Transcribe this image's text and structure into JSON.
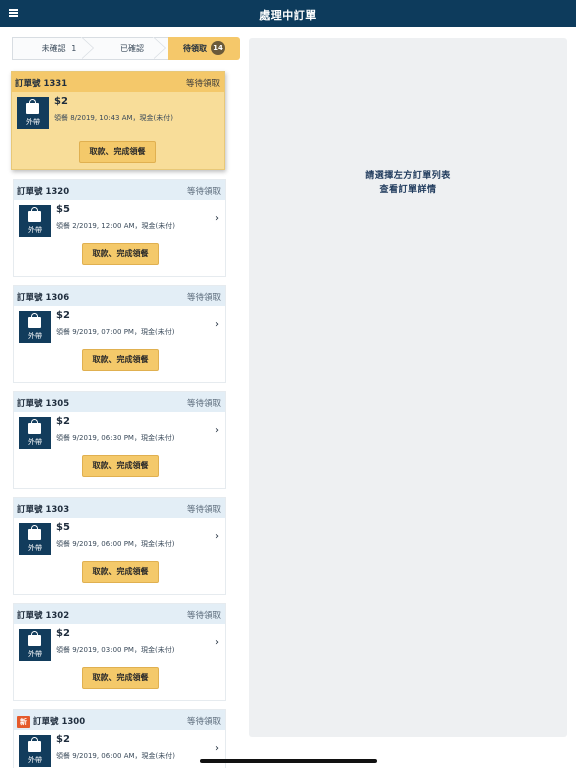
{
  "header": {
    "title": "處理中訂單",
    "menu_icon": "menu-icon"
  },
  "steps": [
    {
      "label": "未確認",
      "count": "1"
    },
    {
      "label": "已確認"
    },
    {
      "label": "待領取",
      "count": "14"
    }
  ],
  "orders": [
    {
      "order_no": "訂單號 1331",
      "status": "等待領取",
      "type_label": "外帶",
      "price": "$2",
      "detail": "領餐 8/2019, 10:43 AM，現金(未付)",
      "action": "取款、完成領餐",
      "selected": true
    },
    {
      "order_no": "訂單號 1320",
      "status": "等待領取",
      "type_label": "外帶",
      "price": "$5",
      "detail": "領餐 2/2019, 12:00 AM，現金(未付)",
      "action": "取款、完成領餐"
    },
    {
      "order_no": "訂單號 1306",
      "status": "等待領取",
      "type_label": "外帶",
      "price": "$2",
      "detail": "領餐 9/2019, 07:00 PM，現金(未付)",
      "action": "取款、完成領餐"
    },
    {
      "order_no": "訂單號 1305",
      "status": "等待領取",
      "type_label": "外帶",
      "price": "$2",
      "detail": "領餐 9/2019, 06:30 PM，現金(未付)",
      "action": "取款、完成領餐"
    },
    {
      "order_no": "訂單號 1303",
      "status": "等待領取",
      "type_label": "外帶",
      "price": "$5",
      "detail": "領餐 9/2019, 06:00 PM，現金(未付)",
      "action": "取款、完成領餐"
    },
    {
      "order_no": "訂單號 1302",
      "status": "等待領取",
      "type_label": "外帶",
      "price": "$2",
      "detail": "領餐 9/2019, 03:00 PM，現金(未付)",
      "action": "取款、完成領餐"
    },
    {
      "order_no": "訂單號 1300",
      "new_tag": "新",
      "status": "等待領取",
      "type_label": "外帶",
      "price": "$2",
      "detail": "領餐 9/2019, 06:00 AM，現金(未付)",
      "action": "取款、完成領餐"
    }
  ],
  "detail_pane": {
    "line1": "請選擇左方訂單列表",
    "line2": "查看訂單詳情"
  },
  "colors": {
    "navy": "#0d3b5c",
    "accent": "#f4c96a",
    "selected_bg": "#f8dd99",
    "new_tag": "#e55a2b"
  }
}
